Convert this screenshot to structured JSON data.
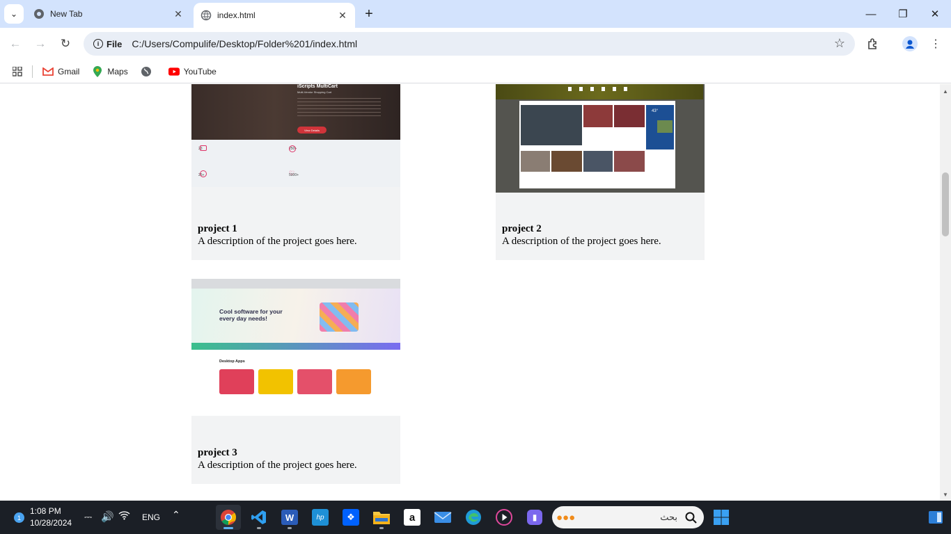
{
  "browser": {
    "tabs": [
      {
        "title": "New Tab"
      },
      {
        "title": "index.html"
      }
    ],
    "address": {
      "scheme_chip": "File",
      "url": "C:/Users/Compulife/Desktop/Folder%201/index.html"
    },
    "bookmarks": [
      {
        "label": "Gmail",
        "icon": "gmail-icon"
      },
      {
        "label": "Maps",
        "icon": "maps-icon"
      },
      {
        "label": "",
        "icon": "globe-icon"
      },
      {
        "label": "YouTube",
        "icon": "youtube-icon"
      }
    ]
  },
  "page": {
    "projects": [
      {
        "title": "project 1",
        "description": "A description of the project goes here.",
        "thumb": {
          "heading": "iScripts MultiCart",
          "subheading": "Multi-Vendor Shopping Cart",
          "button": "View Details",
          "stats": [
            "23",
            "250+",
            "25+",
            "5000+"
          ]
        }
      },
      {
        "title": "project 2",
        "description": "A description of the project goes here.",
        "thumb": {
          "weather": "43°"
        }
      },
      {
        "title": "project 3",
        "description": "A description of the project goes here.",
        "thumb": {
          "hero": "Cool software for your every day needs!",
          "section": "Desktop Apps"
        }
      }
    ]
  },
  "taskbar": {
    "notification_count": "1",
    "time": "1:08 PM",
    "date": "10/28/2024",
    "language": "ENG",
    "search_placeholder": "بحث",
    "apps": [
      "chrome",
      "vscode",
      "word",
      "myhp",
      "dropbox",
      "file-explorer",
      "amazon",
      "mail",
      "edge",
      "media-player",
      "teams",
      "widgets"
    ]
  },
  "colors": {
    "tabstrip": "#d3e3fd",
    "omnibox": "#e9eef6",
    "card": "#f2f3f4",
    "taskbar": "#1b1f26"
  }
}
